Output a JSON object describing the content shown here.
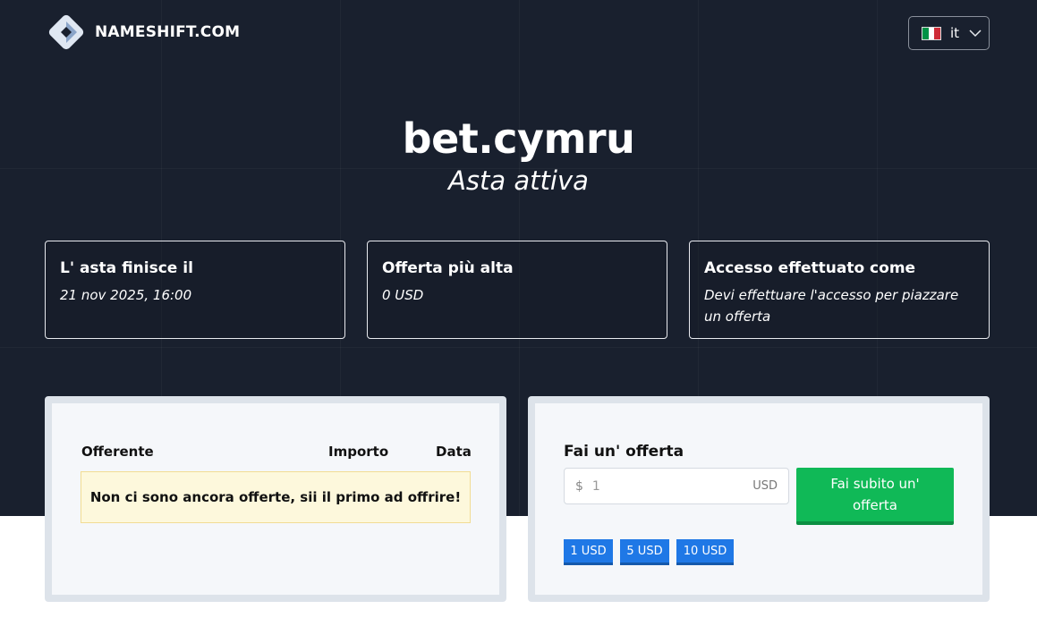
{
  "header": {
    "brand": "NAMESHIFT.COM",
    "language": "it",
    "flag_colors": [
      "#009246",
      "#ffffff",
      "#ce2b37"
    ]
  },
  "hero": {
    "domain": "bet.cymru",
    "status": "Asta attiva"
  },
  "info": [
    {
      "heading": "L' asta finisce il",
      "value": "21 nov 2025, 16:00"
    },
    {
      "heading": "Offerta più alta",
      "value": "0 USD"
    },
    {
      "heading": "Accesso effettuato come",
      "value": "Devi effettuare l'accesso per piazzare un offerta"
    }
  ],
  "bids_table": {
    "columns": [
      "Offerente",
      "Importo",
      "Data"
    ],
    "empty_message": "Non ci sono ancora offerte, sii il primo ad offrire!"
  },
  "bid_form": {
    "title": "Fai un' offerta",
    "currency_symbol": "$",
    "amount_placeholder": "1",
    "currency_unit": "USD",
    "submit_label": "Fai subito un' offerta",
    "quick_increments": [
      "1 USD",
      "5 USD",
      "10 USD"
    ]
  },
  "colors": {
    "hero_bg": "#19202e",
    "submit": "#10b957",
    "chip": "#1f78e6",
    "notice_bg": "#fdf8dc"
  }
}
